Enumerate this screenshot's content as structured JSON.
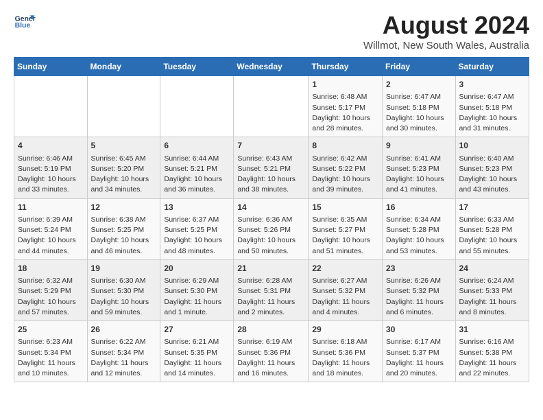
{
  "header": {
    "logo_line1": "General",
    "logo_line2": "Blue",
    "title": "August 2024",
    "subtitle": "Willmot, New South Wales, Australia"
  },
  "days": [
    "Sunday",
    "Monday",
    "Tuesday",
    "Wednesday",
    "Thursday",
    "Friday",
    "Saturday"
  ],
  "weeks": [
    [
      {
        "date": "",
        "content": ""
      },
      {
        "date": "",
        "content": ""
      },
      {
        "date": "",
        "content": ""
      },
      {
        "date": "",
        "content": ""
      },
      {
        "date": "1",
        "content": "Sunrise: 6:48 AM\nSunset: 5:17 PM\nDaylight: 10 hours\nand 28 minutes."
      },
      {
        "date": "2",
        "content": "Sunrise: 6:47 AM\nSunset: 5:18 PM\nDaylight: 10 hours\nand 30 minutes."
      },
      {
        "date": "3",
        "content": "Sunrise: 6:47 AM\nSunset: 5:18 PM\nDaylight: 10 hours\nand 31 minutes."
      }
    ],
    [
      {
        "date": "4",
        "content": "Sunrise: 6:46 AM\nSunset: 5:19 PM\nDaylight: 10 hours\nand 33 minutes."
      },
      {
        "date": "5",
        "content": "Sunrise: 6:45 AM\nSunset: 5:20 PM\nDaylight: 10 hours\nand 34 minutes."
      },
      {
        "date": "6",
        "content": "Sunrise: 6:44 AM\nSunset: 5:21 PM\nDaylight: 10 hours\nand 36 minutes."
      },
      {
        "date": "7",
        "content": "Sunrise: 6:43 AM\nSunset: 5:21 PM\nDaylight: 10 hours\nand 38 minutes."
      },
      {
        "date": "8",
        "content": "Sunrise: 6:42 AM\nSunset: 5:22 PM\nDaylight: 10 hours\nand 39 minutes."
      },
      {
        "date": "9",
        "content": "Sunrise: 6:41 AM\nSunset: 5:23 PM\nDaylight: 10 hours\nand 41 minutes."
      },
      {
        "date": "10",
        "content": "Sunrise: 6:40 AM\nSunset: 5:23 PM\nDaylight: 10 hours\nand 43 minutes."
      }
    ],
    [
      {
        "date": "11",
        "content": "Sunrise: 6:39 AM\nSunset: 5:24 PM\nDaylight: 10 hours\nand 44 minutes."
      },
      {
        "date": "12",
        "content": "Sunrise: 6:38 AM\nSunset: 5:25 PM\nDaylight: 10 hours\nand 46 minutes."
      },
      {
        "date": "13",
        "content": "Sunrise: 6:37 AM\nSunset: 5:25 PM\nDaylight: 10 hours\nand 48 minutes."
      },
      {
        "date": "14",
        "content": "Sunrise: 6:36 AM\nSunset: 5:26 PM\nDaylight: 10 hours\nand 50 minutes."
      },
      {
        "date": "15",
        "content": "Sunrise: 6:35 AM\nSunset: 5:27 PM\nDaylight: 10 hours\nand 51 minutes."
      },
      {
        "date": "16",
        "content": "Sunrise: 6:34 AM\nSunset: 5:28 PM\nDaylight: 10 hours\nand 53 minutes."
      },
      {
        "date": "17",
        "content": "Sunrise: 6:33 AM\nSunset: 5:28 PM\nDaylight: 10 hours\nand 55 minutes."
      }
    ],
    [
      {
        "date": "18",
        "content": "Sunrise: 6:32 AM\nSunset: 5:29 PM\nDaylight: 10 hours\nand 57 minutes."
      },
      {
        "date": "19",
        "content": "Sunrise: 6:30 AM\nSunset: 5:30 PM\nDaylight: 10 hours\nand 59 minutes."
      },
      {
        "date": "20",
        "content": "Sunrise: 6:29 AM\nSunset: 5:30 PM\nDaylight: 11 hours\nand 1 minute."
      },
      {
        "date": "21",
        "content": "Sunrise: 6:28 AM\nSunset: 5:31 PM\nDaylight: 11 hours\nand 2 minutes."
      },
      {
        "date": "22",
        "content": "Sunrise: 6:27 AM\nSunset: 5:32 PM\nDaylight: 11 hours\nand 4 minutes."
      },
      {
        "date": "23",
        "content": "Sunrise: 6:26 AM\nSunset: 5:32 PM\nDaylight: 11 hours\nand 6 minutes."
      },
      {
        "date": "24",
        "content": "Sunrise: 6:24 AM\nSunset: 5:33 PM\nDaylight: 11 hours\nand 8 minutes."
      }
    ],
    [
      {
        "date": "25",
        "content": "Sunrise: 6:23 AM\nSunset: 5:34 PM\nDaylight: 11 hours\nand 10 minutes."
      },
      {
        "date": "26",
        "content": "Sunrise: 6:22 AM\nSunset: 5:34 PM\nDaylight: 11 hours\nand 12 minutes."
      },
      {
        "date": "27",
        "content": "Sunrise: 6:21 AM\nSunset: 5:35 PM\nDaylight: 11 hours\nand 14 minutes."
      },
      {
        "date": "28",
        "content": "Sunrise: 6:19 AM\nSunset: 5:36 PM\nDaylight: 11 hours\nand 16 minutes."
      },
      {
        "date": "29",
        "content": "Sunrise: 6:18 AM\nSunset: 5:36 PM\nDaylight: 11 hours\nand 18 minutes."
      },
      {
        "date": "30",
        "content": "Sunrise: 6:17 AM\nSunset: 5:37 PM\nDaylight: 11 hours\nand 20 minutes."
      },
      {
        "date": "31",
        "content": "Sunrise: 6:16 AM\nSunset: 5:38 PM\nDaylight: 11 hours\nand 22 minutes."
      }
    ]
  ]
}
